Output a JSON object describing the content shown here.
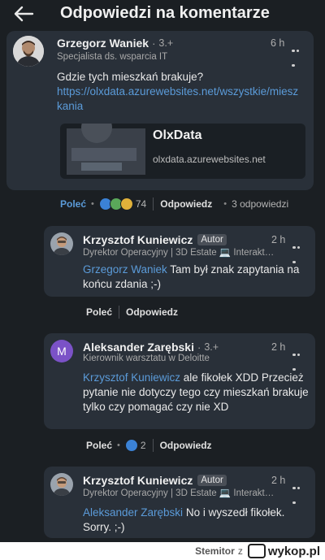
{
  "header": {
    "title": "Odpowiedzi na komentarze"
  },
  "main_comment": {
    "author": "Grzegorz Waniek",
    "rank": "3.+",
    "time": "6 h",
    "subtitle": "Specjalista ds. wsparcia IT",
    "text": "Gdzie tych mieszkań brakuje?",
    "link": "https://olxdata.azurewebsites.net/wszystkie/mieszkania",
    "preview": {
      "title": "OlxData",
      "url": "olxdata.azurewebsites.net"
    },
    "actions": {
      "recommend": "Poleć",
      "reactions_count": "74",
      "reply": "Odpowiedz",
      "replies": "3 odpowiedzi"
    }
  },
  "replies": [
    {
      "author": "Krzysztof Kuniewicz",
      "badge": "Autor",
      "time": "2 h",
      "subtitle": "Dyrektor Operacyjny | 3D Estate 💻 Interakt…",
      "mention": "Grzegorz Waniek",
      "text": " Tam był znak zapytania na końcu zdania ;-)",
      "actions": {
        "recommend": "Poleć",
        "reply": "Odpowiedz"
      }
    },
    {
      "author": "Aleksander Zarębski",
      "rank": "3.+",
      "time": "2 h",
      "subtitle": "Kierownik warsztatu w Deloitte",
      "avatar_letter": "M",
      "mention": "Krzysztof Kuniewicz",
      "text": " ale fikołek XDD Przecież pytanie nie dotyczy tego czy mieszkań brakuje tylko czy pomagać czy nie XD",
      "actions": {
        "recommend": "Poleć",
        "reactions_count": "2",
        "reply": "Odpowiedz"
      }
    },
    {
      "author": "Krzysztof Kuniewicz",
      "badge": "Autor",
      "time": "2 h",
      "subtitle": "Dyrektor Operacyjny | 3D Estate 💻 Interakt…",
      "mention": "Aleksander Zarębski",
      "text": " No i wyszedł fikołek. Sorry. ;-)"
    }
  ],
  "footer": {
    "user": "Stemitor",
    "z": "z",
    "brand": "wykop.pl"
  },
  "colors": {
    "background": "#1b1f23",
    "card": "#293039",
    "link": "#5b9bd9",
    "avatar_m": "#7b52c7"
  }
}
